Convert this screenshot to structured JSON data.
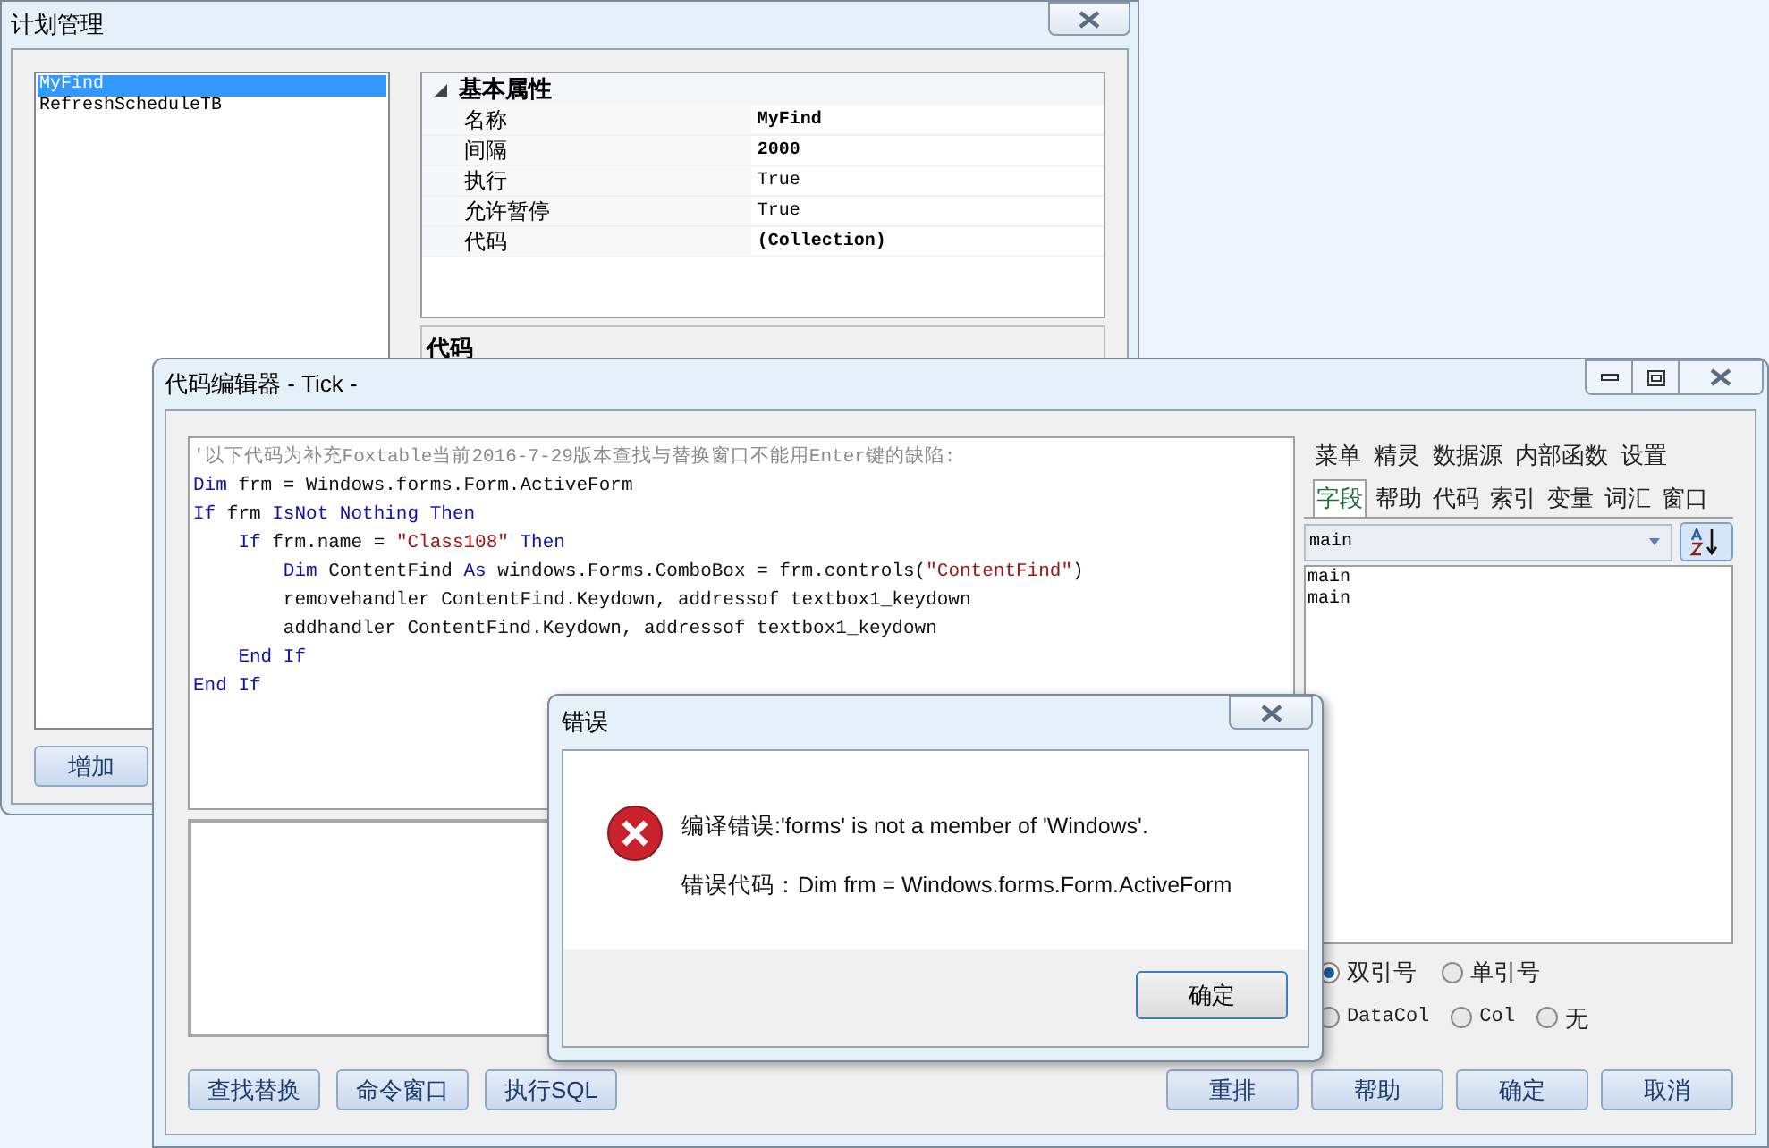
{
  "plan_window": {
    "title": "计划管理",
    "tasks": [
      {
        "label": "MyFind",
        "selected": true
      },
      {
        "label": "RefreshScheduleTB",
        "selected": false
      }
    ],
    "property_grid": {
      "category": "基本属性",
      "expanded": true,
      "rows": [
        {
          "name": "名称",
          "value": "MyFind",
          "bold": true
        },
        {
          "name": "间隔",
          "value": "2000",
          "bold": true
        },
        {
          "name": "执行",
          "value": "True",
          "bold": false
        },
        {
          "name": "允许暂停",
          "value": "True",
          "bold": false
        },
        {
          "name": "代码",
          "value": "(Collection)",
          "bold": true
        }
      ]
    },
    "code_section": "代码",
    "add_button": "增加"
  },
  "code_editor": {
    "title": "代码编辑器 - Tick -",
    "code_lines": [
      [
        {
          "kind": "comment",
          "text": "'以下代码为补充Foxtable当前2016-7-29版本查找与替换窗口不能用Enter键的缺陷:"
        }
      ],
      [
        {
          "kind": "keyword",
          "text": "Dim"
        },
        {
          "kind": "plain",
          "text": " frm = Windows.forms.Form.ActiveForm"
        }
      ],
      [
        {
          "kind": "keyword",
          "text": "If"
        },
        {
          "kind": "plain",
          "text": " frm "
        },
        {
          "kind": "keyword",
          "text": "IsNot Nothing Then"
        }
      ],
      [
        {
          "kind": "keyword",
          "text": "    If"
        },
        {
          "kind": "plain",
          "text": " frm.name = "
        },
        {
          "kind": "string",
          "text": "\"Class108\""
        },
        {
          "kind": "keyword",
          "text": " Then"
        }
      ],
      [
        {
          "kind": "keyword",
          "text": "        Dim"
        },
        {
          "kind": "plain",
          "text": " ContentFind "
        },
        {
          "kind": "keyword",
          "text": "As"
        },
        {
          "kind": "plain",
          "text": " windows.Forms.ComboBox = frm.controls("
        },
        {
          "kind": "string",
          "text": "\"ContentFind\""
        },
        {
          "kind": "plain",
          "text": ")"
        }
      ],
      [
        {
          "kind": "plain",
          "text": "        removehandler ContentFind.Keydown, addressof textbox1_keydown"
        }
      ],
      [
        {
          "kind": "plain",
          "text": "        addhandler ContentFind.Keydown, addressof textbox1_keydown"
        }
      ],
      [
        {
          "kind": "keyword",
          "text": "    End If"
        }
      ],
      [
        {
          "kind": "keyword",
          "text": "End If"
        }
      ]
    ],
    "tab_rows": [
      [
        {
          "label": "菜单",
          "selected": false
        },
        {
          "label": "精灵",
          "selected": false
        },
        {
          "label": "数据源",
          "selected": false
        },
        {
          "label": "内部函数",
          "selected": false
        },
        {
          "label": "设置",
          "selected": false
        }
      ],
      [
        {
          "label": "字段",
          "selected": true
        },
        {
          "label": "帮助",
          "selected": false
        },
        {
          "label": "代码",
          "selected": false
        },
        {
          "label": "索引",
          "selected": false
        },
        {
          "label": "变量",
          "selected": false
        },
        {
          "label": "词汇",
          "selected": false
        },
        {
          "label": "窗口",
          "selected": false
        }
      ]
    ],
    "combo_value": "main",
    "list_items": [
      "main",
      "main"
    ],
    "quote_options": [
      {
        "label": "双引号",
        "selected": true,
        "kind": "text"
      },
      {
        "label": "单引号",
        "selected": false,
        "kind": "text"
      }
    ],
    "column_options": [
      {
        "label": "DataCol",
        "selected": false,
        "kind": "code"
      },
      {
        "label": "Col",
        "selected": false,
        "kind": "code"
      },
      {
        "label": "无",
        "selected": false,
        "kind": "text"
      }
    ],
    "left_buttons": [
      "查找替换",
      "命令窗口",
      "执行SQL"
    ],
    "right_buttons": [
      "重排",
      "帮助",
      "确定",
      "取消"
    ]
  },
  "error_dialog": {
    "title": "错误",
    "message": "编译错误:'forms' is not a member of 'Windows'.",
    "detail": "错误代码：Dim frm = Windows.forms.Form.ActiveForm",
    "ok_button": "确定"
  }
}
